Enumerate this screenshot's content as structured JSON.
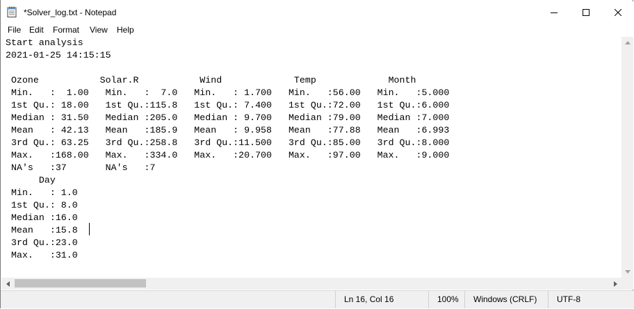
{
  "window": {
    "title": "*Solver_log.txt - Notepad",
    "app_icon": "notepad-icon",
    "controls": [
      "minimize-icon",
      "maximize-icon",
      "close-icon"
    ]
  },
  "menu": [
    "File",
    "Edit",
    "Format",
    "View",
    "Help"
  ],
  "editor": {
    "lines": [
      "Start analysis",
      "2021-01-25 14:15:15",
      "",
      " Ozone           Solar.R           Wind             Temp             Month",
      " Min.   :  1.00   Min.   :  7.0   Min.   : 1.700   Min.   :56.00   Min.   :5.000",
      " 1st Qu.: 18.00   1st Qu.:115.8   1st Qu.: 7.400   1st Qu.:72.00   1st Qu.:6.000",
      " Median : 31.50   Median :205.0   Median : 9.700   Median :79.00   Median :7.000",
      " Mean   : 42.13   Mean   :185.9   Mean   : 9.958   Mean   :77.88   Mean   :6.993",
      " 3rd Qu.: 63.25   3rd Qu.:258.8   3rd Qu.:11.500   3rd Qu.:85.00   3rd Qu.:8.000",
      " Max.   :168.00   Max.   :334.0   Max.   :20.700   Max.   :97.00   Max.   :9.000",
      " NA's   :37       NA's   :7",
      "      Day",
      " Min.   : 1.0",
      " 1st Qu.: 8.0",
      " Median :16.0",
      " Mean   :15.8",
      " 3rd Qu.:23.0",
      " Max.   :31.0"
    ]
  },
  "statusbar": {
    "position": "Ln 16, Col 16",
    "zoom": "100%",
    "line_ending": "Windows (CRLF)",
    "encoding": "UTF-8"
  },
  "colors": {
    "chrome_bg": "#f0f0f0",
    "scroll_thumb": "#c2c2c2",
    "text": "#000000"
  }
}
